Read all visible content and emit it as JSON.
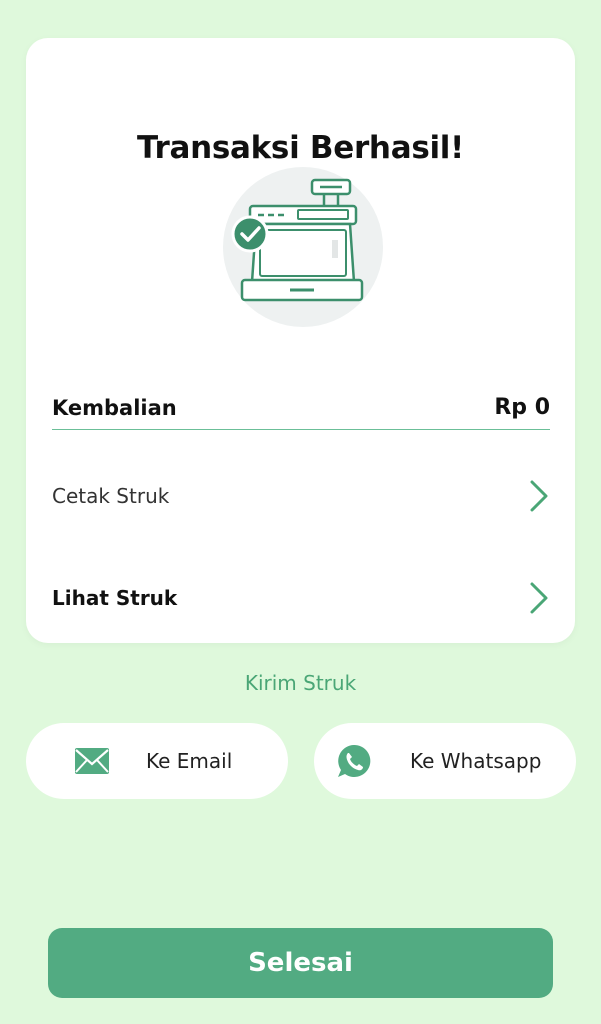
{
  "card": {
    "title": "Transaksi Berhasil!",
    "illustration_icon": "cash-register-success-icon",
    "change": {
      "label": "Kembalian",
      "value": "Rp 0"
    },
    "menu": [
      {
        "label": "Cetak Struk",
        "icon": "chevron-right-icon"
      },
      {
        "label": "Lihat Struk",
        "icon": "chevron-right-icon"
      }
    ]
  },
  "send": {
    "title": "Kirim Struk",
    "options": [
      {
        "label": "Ke Email",
        "icon": "email-icon"
      },
      {
        "label": "Ke Whatsapp",
        "icon": "whatsapp-icon"
      }
    ]
  },
  "footer": {
    "done_label": "Selesai"
  },
  "colors": {
    "background": "#dff9dc",
    "accent": "#52ab82",
    "accent_text": "#4aa676",
    "divider": "#6bbf98"
  }
}
